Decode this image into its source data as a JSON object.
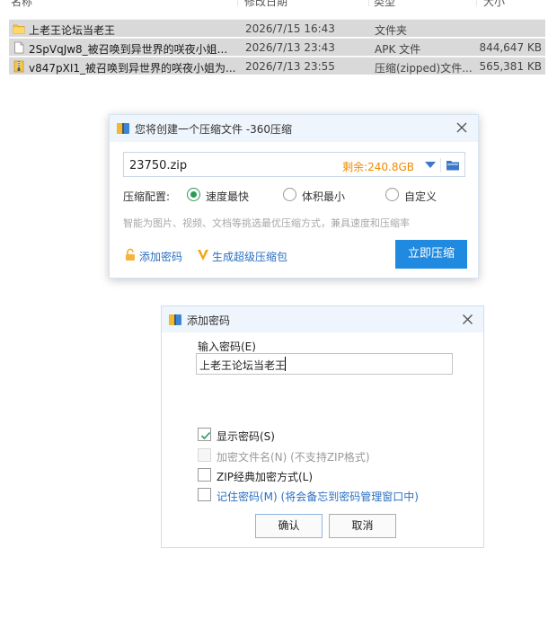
{
  "explorer": {
    "columns": [
      "名称",
      "修改日期",
      "类型",
      "大小"
    ],
    "files": [
      {
        "name": "上老王论坛当老王",
        "date": "2026/7/15 16:43",
        "type": "文件夹",
        "size": "",
        "icon": "folder-icon"
      },
      {
        "name": "2SpVqJw8_被召唤到异世界的咲夜小姐...",
        "date": "2026/7/13 23:43",
        "type": "APK 文件",
        "size": "844,647 KB",
        "icon": "file-icon"
      },
      {
        "name": "v847pXI1_被召唤到异世界的咲夜小姐为...",
        "date": "2026/7/13 23:55",
        "type": "压缩(zipped)文件...",
        "size": "565,381 KB",
        "icon": "zip-file-icon"
      }
    ]
  },
  "compress_dialog": {
    "title": "您将创建一个压缩文件 -360压缩",
    "filename": "23750.zip",
    "free_space": "剩余:240.8GB",
    "config_label": "压缩配置:",
    "options": [
      {
        "label": "速度最快",
        "selected": true
      },
      {
        "label": "体积最小",
        "selected": false
      },
      {
        "label": "自定义",
        "selected": false
      }
    ],
    "hint": "智能为图片、视频、文档等挑选最优压缩方式，兼具速度和压缩率",
    "add_password": "添加密码",
    "super_package": "生成超级压缩包",
    "compress_button": "立即压缩",
    "accent_color": "#1f8ae0"
  },
  "password_dialog": {
    "title": "添加密码",
    "input_label": "输入密码(E)",
    "password_value": "上老王论坛当老王",
    "checkboxes": [
      {
        "label": "显示密码(S)",
        "checked": true,
        "enabled": true
      },
      {
        "label": "加密文件名(N) (不支持ZIP格式)",
        "checked": false,
        "enabled": false
      },
      {
        "label": "ZIP经典加密方式(L)",
        "checked": false,
        "enabled": true
      },
      {
        "label": "记住密码(M) (将会备忘到密码管理窗口中)",
        "checked": false,
        "enabled": true
      }
    ],
    "ok_button": "确认",
    "cancel_button": "取消"
  }
}
